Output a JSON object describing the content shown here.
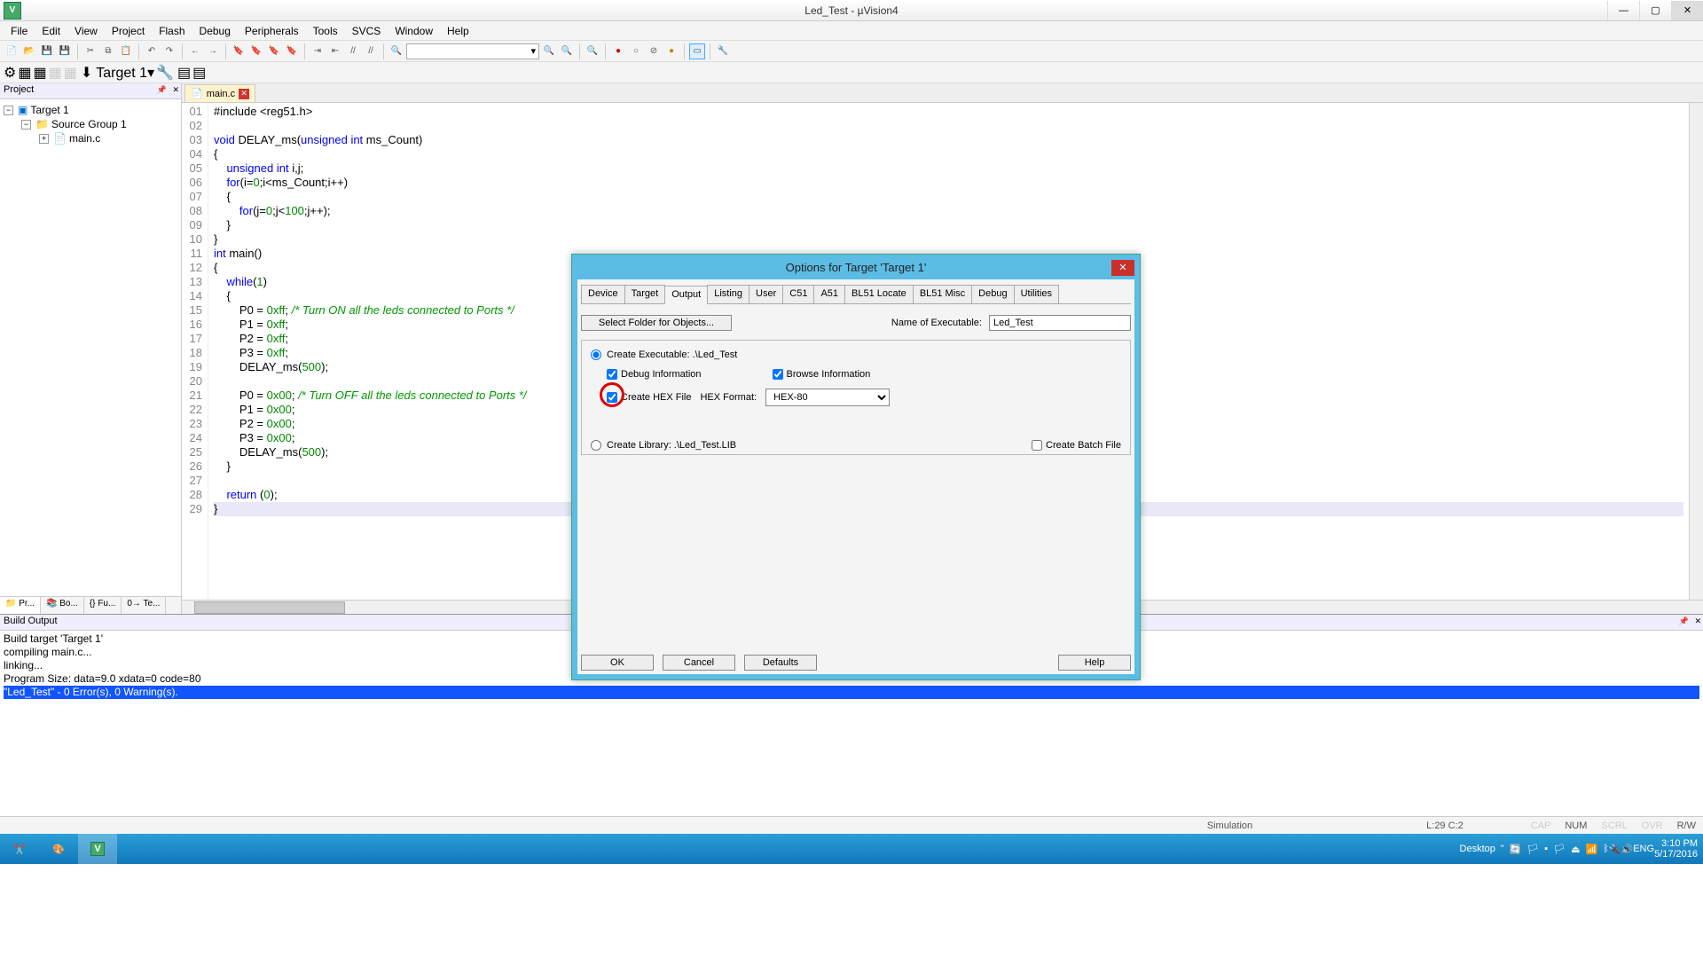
{
  "window": {
    "title": "Led_Test  - µVision4",
    "controls": {
      "min": "—",
      "max": "▢",
      "close": "✕"
    }
  },
  "menu": [
    "File",
    "Edit",
    "View",
    "Project",
    "Flash",
    "Debug",
    "Peripherals",
    "Tools",
    "SVCS",
    "Window",
    "Help"
  ],
  "target_combo": "Target 1",
  "project_panel": {
    "title": "Project",
    "root": "Target 1",
    "group": "Source Group 1",
    "file": "main.c",
    "tabs": [
      "Pr...",
      "Bo...",
      "Fu...",
      "Te..."
    ]
  },
  "editor": {
    "tab": "main.c",
    "lines": [
      "#include <reg51.h>",
      "",
      "void DELAY_ms(unsigned int ms_Count)",
      "{",
      "    unsigned int i,j;",
      "    for(i=0;i<ms_Count;i++)",
      "    {",
      "        for(j=0;j<100;j++);",
      "    }",
      "}",
      "int main()",
      "{",
      "    while(1)",
      "    {",
      "        P0 = 0xff; /* Turn ON all the leds connected to Ports */",
      "        P1 = 0xff;",
      "        P2 = 0xff;",
      "        P3 = 0xff;",
      "        DELAY_ms(500);",
      "",
      "        P0 = 0x00; /* Turn OFF all the leds connected to Ports */",
      "        P1 = 0x00;",
      "        P2 = 0x00;",
      "        P3 = 0x00;",
      "        DELAY_ms(500);",
      "    }",
      "",
      "    return (0);",
      "}"
    ]
  },
  "build": {
    "title": "Build Output",
    "lines": [
      "Build target 'Target 1'",
      "compiling main.c...",
      "linking...",
      "Program Size: data=9.0 xdata=0 code=80",
      "\"Led_Test\" - 0 Error(s), 0 Warning(s)."
    ]
  },
  "status": {
    "mode": "Simulation",
    "cursor": "L:29 C:2",
    "caps": "CAP",
    "num": "NUM",
    "scrl": "SCRL",
    "ovr": "OVR",
    "rw": "R/W"
  },
  "dialog": {
    "title": "Options for Target 'Target 1'",
    "tabs": [
      "Device",
      "Target",
      "Output",
      "Listing",
      "User",
      "C51",
      "A51",
      "BL51 Locate",
      "BL51 Misc",
      "Debug",
      "Utilities"
    ],
    "active_tab": "Output",
    "select_folder_btn": "Select Folder for Objects...",
    "name_exe_label": "Name of Executable:",
    "name_exe_value": "Led_Test",
    "create_exe_label": "Create Executable:  .\\Led_Test",
    "debug_info": "Debug Information",
    "browse_info": "Browse Information",
    "create_hex": "Create HEX File",
    "hex_format_label": "HEX Format:",
    "hex_format_value": "HEX-80",
    "create_lib_label": "Create Library:  .\\Led_Test.LIB",
    "create_batch": "Create Batch File",
    "ok": "OK",
    "cancel": "Cancel",
    "defaults": "Defaults",
    "help": "Help"
  },
  "taskbar": {
    "desktop": "Desktop",
    "lang": "ENG",
    "time": "3:10 PM",
    "date": "5/17/2016"
  }
}
